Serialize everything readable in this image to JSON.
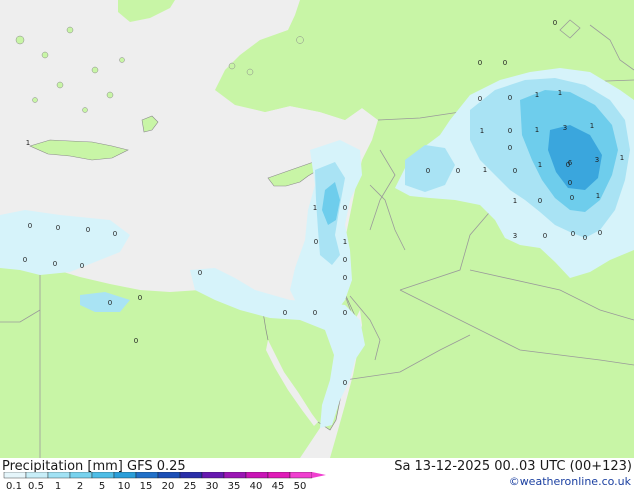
{
  "title": {
    "variable": "Precipitation [mm]",
    "model": "GFS 0.25",
    "datetime": "Sa 13-12-2025 00..03 UTC (00+123)"
  },
  "credit": "©weatheronline.co.uk",
  "legend": {
    "labels": [
      "0.1",
      "0.5",
      "1",
      "2",
      "5",
      "10",
      "15",
      "20",
      "25",
      "30",
      "35",
      "40",
      "45",
      "50"
    ],
    "colors": [
      "#e6f6fb",
      "#c8eef8",
      "#a2e2f4",
      "#78d2ee",
      "#4fbde6",
      "#2b9ed9",
      "#2170c8",
      "#1c4fb6",
      "#2a2ea8",
      "#6619b0",
      "#9b16b4",
      "#c915b6",
      "#e01bb8",
      "#f03fd0"
    ]
  },
  "map": {
    "colors": {
      "sea": "#eeeeee",
      "land": "#c8f5a6",
      "border": "#9a9a9a",
      "coast": "#8a8a8a",
      "p1": "#d6f3fa",
      "p2": "#a9e3f4",
      "p3": "#6ecdec",
      "p4": "#3aa6dd"
    },
    "point_values": [
      {
        "v": "0"
      },
      {
        "v": "0"
      },
      {
        "v": "0"
      },
      {
        "v": "0"
      },
      {
        "v": "0"
      },
      {
        "v": "0"
      },
      {
        "v": "0"
      },
      {
        "v": "0"
      },
      {
        "v": "0"
      },
      {
        "v": "0"
      },
      {
        "v": "0"
      },
      {
        "v": "0"
      },
      {
        "v": "0"
      },
      {
        "v": "0"
      },
      {
        "v": "0"
      },
      {
        "v": "1"
      },
      {
        "v": "0"
      },
      {
        "v": "0"
      },
      {
        "v": "1"
      },
      {
        "v": "0"
      },
      {
        "v": "0"
      },
      {
        "v": "0"
      },
      {
        "v": "0"
      },
      {
        "v": "0"
      },
      {
        "v": "1"
      },
      {
        "v": "0"
      },
      {
        "v": "0"
      },
      {
        "v": "0"
      },
      {
        "v": "1"
      },
      {
        "v": "1"
      },
      {
        "v": "1"
      },
      {
        "v": "0"
      },
      {
        "v": "1"
      },
      {
        "v": "3"
      },
      {
        "v": "1"
      },
      {
        "v": "0"
      },
      {
        "v": "1"
      },
      {
        "v": "0"
      },
      {
        "v": "6"
      },
      {
        "v": "3"
      },
      {
        "v": "1"
      },
      {
        "v": "1"
      },
      {
        "v": "0"
      },
      {
        "v": "0"
      },
      {
        "v": "1"
      },
      {
        "v": "3"
      },
      {
        "v": "0"
      },
      {
        "v": "0"
      },
      {
        "v": "0"
      },
      {
        "v": "1"
      },
      {
        "v": "0"
      },
      {
        "v": "0"
      },
      {
        "v": "0"
      },
      {
        "v": "0"
      }
    ]
  }
}
